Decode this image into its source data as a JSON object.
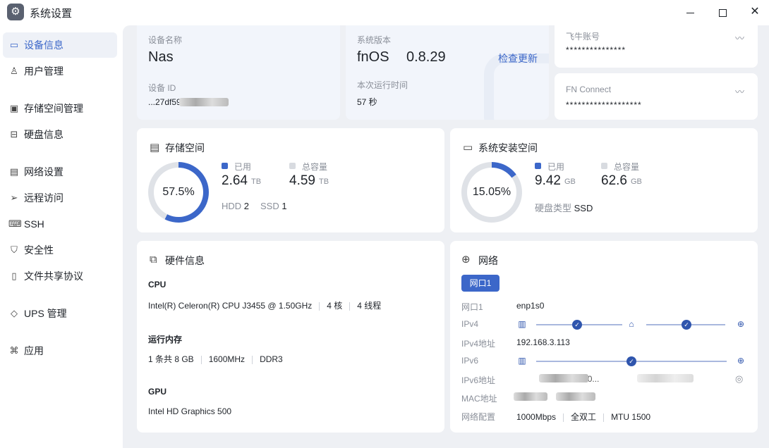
{
  "window": {
    "title": "系统设置",
    "icons": [
      "gear-icon",
      "minimize-icon",
      "maximize-icon",
      "close-icon"
    ]
  },
  "sidebar": {
    "items": [
      {
        "label": "设备信息",
        "icon": "device-icon",
        "active": true
      },
      {
        "label": "用户管理",
        "icon": "user-icon"
      },
      {
        "label": "存储空间管理",
        "icon": "storage-icon"
      },
      {
        "label": "硬盘信息",
        "icon": "disk-icon"
      },
      {
        "label": "网络设置",
        "icon": "network-icon"
      },
      {
        "label": "远程访问",
        "icon": "send-icon"
      },
      {
        "label": "SSH",
        "icon": "code-icon"
      },
      {
        "label": "安全性",
        "icon": "shield-icon"
      },
      {
        "label": "文件共享协议",
        "icon": "file-icon"
      },
      {
        "label": "UPS 管理",
        "icon": "ups-icon"
      },
      {
        "label": "应用",
        "icon": "apps-icon"
      }
    ]
  },
  "device": {
    "name_label": "设备名称",
    "name": "Nas",
    "id_label": "设备 ID",
    "id_visible": "...27df590...8occ..."
  },
  "system": {
    "version_label": "系统版本",
    "os": "fnOS",
    "version": "0.8.29",
    "check_update": "检查更新",
    "uptime_label": "本次运行时间",
    "uptime": "57 秒"
  },
  "accounts": {
    "feiniu_label": "飞牛账号",
    "feiniu_value": "***************",
    "fnconnect_label": "FN Connect",
    "fnconnect_value": "*******************"
  },
  "storage": {
    "title": "存储空间",
    "percent_label": "57.5%",
    "used_fraction": 0.575,
    "used_label": "已用",
    "used": "2.64",
    "used_unit": "TB",
    "total_label": "总容量",
    "total": "4.59",
    "total_unit": "TB",
    "hdd_label": "HDD",
    "hdd": "2",
    "ssd_label": "SSD",
    "ssd": "1"
  },
  "system_disk": {
    "title": "系统安装空间",
    "percent_label": "15.05%",
    "used_fraction": 0.1505,
    "used_label": "已用",
    "used": "9.42",
    "used_unit": "GB",
    "total_label": "总容量",
    "total": "62.6",
    "total_unit": "GB",
    "disk_type_label": "硬盘类型",
    "disk_type": "SSD"
  },
  "hardware": {
    "title": "硬件信息",
    "cpu_head": "CPU",
    "cpu_model": "Intel(R) Celeron(R) CPU J3455 @ 1.50GHz",
    "cpu_cores": "4 核",
    "cpu_threads": "4 线程",
    "mem_head": "运行内存",
    "mem_count": "1 条共 8 GB",
    "mem_speed": "1600MHz",
    "mem_type": "DDR3",
    "gpu_head": "GPU",
    "gpu_model": "Intel HD Graphics 500"
  },
  "network": {
    "title": "网络",
    "tab": "网口1",
    "rows": [
      {
        "key": "网口1",
        "value": "enp1s0"
      },
      {
        "key": "IPv4",
        "value": ""
      },
      {
        "key": "IPv4地址",
        "value": "192.168.3.113"
      },
      {
        "key": "IPv6",
        "value": ""
      },
      {
        "key": "IPv6地址",
        "value": ""
      },
      {
        "key": "MAC地址",
        "value": ""
      },
      {
        "key": "网络配置",
        "value": ""
      }
    ],
    "ipv6_partial": "...fae4:0...",
    "config_speed": "1000Mbps",
    "config_duplex": "全双工",
    "config_mtu": "MTU 1500",
    "colors": {
      "accent": "#3c67c9",
      "node": "#2f55ad"
    }
  }
}
